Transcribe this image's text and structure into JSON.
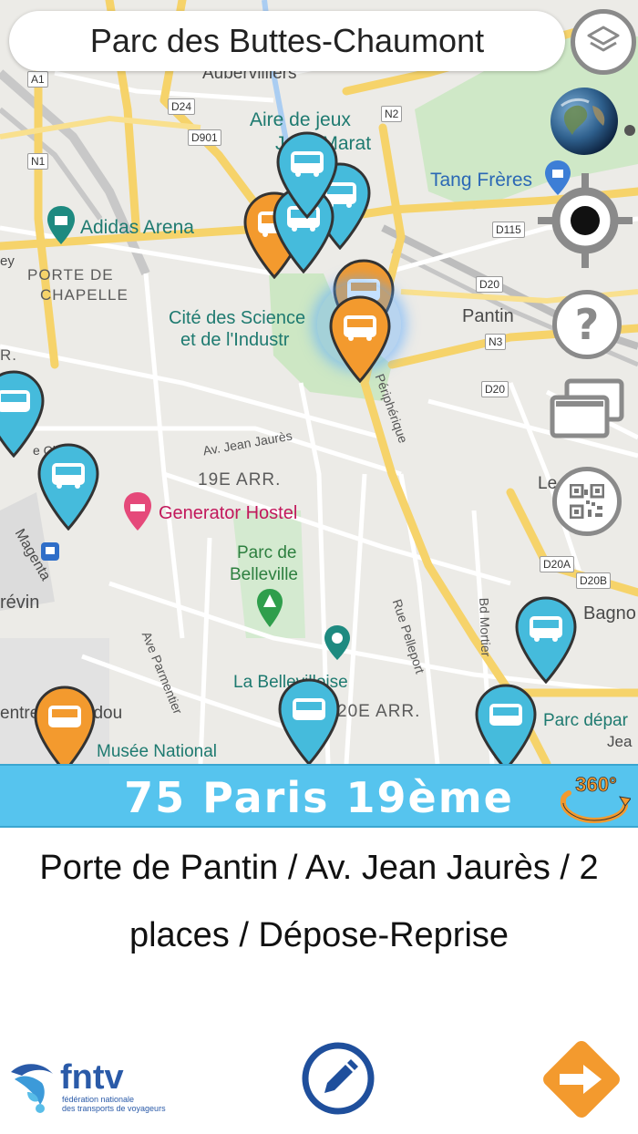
{
  "search": {
    "title": "Parc des Buttes-Chaumont"
  },
  "map": {
    "labels": {
      "aubervilliers": "Aubervilliers",
      "aire_de_jeux": "Aire de jeux",
      "jean_marat": "Jean Marat",
      "tang_freres": "Tang Frères",
      "adidas_arena": "Adidas Arena",
      "porte_de": "PORTE DE",
      "chapelle": "CHAPELLE",
      "cite_sciences_1": "Cité des Science",
      "cite_sciences_2": "et de l'Industr",
      "pantin": "Pantin",
      "av_jean_jaures": "Av. Jean Jaurès",
      "peripherique": "Périphérique",
      "arr_19": "19E ARR.",
      "generator_hostel": "Generator Hostel",
      "parc_de": "Parc de",
      "belleville": "Belleville",
      "la_bellevilloise": "La Bellevilloise",
      "arr_20": "20E ARR.",
      "musee_national": "Musée National",
      "parc_depart": "Parc dépar",
      "rue_pelleport": "Rue Pelleport",
      "ave_parmentier": "Ave Parmentier",
      "bd_mortier": "Bd Mortier",
      "bagnolet": "Bagno",
      "magenta": "Magenta",
      "revin": "révin",
      "ey": "ey",
      "rr": "R.",
      "les_lilas": "Le",
      "centre_pompidou": "entre Pompidou",
      "jea": "Jea",
      "ce": "e Ch"
    },
    "road_shields": {
      "a1": "A1",
      "n1": "N1",
      "d24": "D24",
      "d901": "D901",
      "n2": "N2",
      "n3": "N3",
      "d115": "D115",
      "d20a": "D20",
      "d20b": "D20",
      "d20c": "D20A",
      "d20d": "D20B"
    }
  },
  "controls": {
    "layers": "layers-icon",
    "satellite": "globe-icon",
    "locate": "crosshair-icon",
    "help": "?",
    "windows": "windows-icon",
    "qr": "qr-code-icon"
  },
  "pins": [
    {
      "color": "#45bbdc",
      "type": "bus-stop-pin"
    },
    {
      "color": "#f39a2e",
      "type": "bus-stop-pin"
    },
    {
      "color": "#f39a2e",
      "type": "selected-bus-stop-pin"
    }
  ],
  "panel": {
    "title": "75 Paris 19ème",
    "badge_360": "360°",
    "description": "Porte de Pantin / Av. Jean Jaurès / 2 places / Dépose-Reprise"
  },
  "footer": {
    "logo_text": "fntv",
    "logo_subtitle_1": "fédération nationale",
    "logo_subtitle_2": "des transports de voyageurs"
  },
  "colors": {
    "accent_blue": "#56c4ee",
    "pin_blue": "#45bbdc",
    "pin_orange": "#f39a2e",
    "edit_blue": "#1f4f9c",
    "next_orange": "#f39a2e"
  }
}
